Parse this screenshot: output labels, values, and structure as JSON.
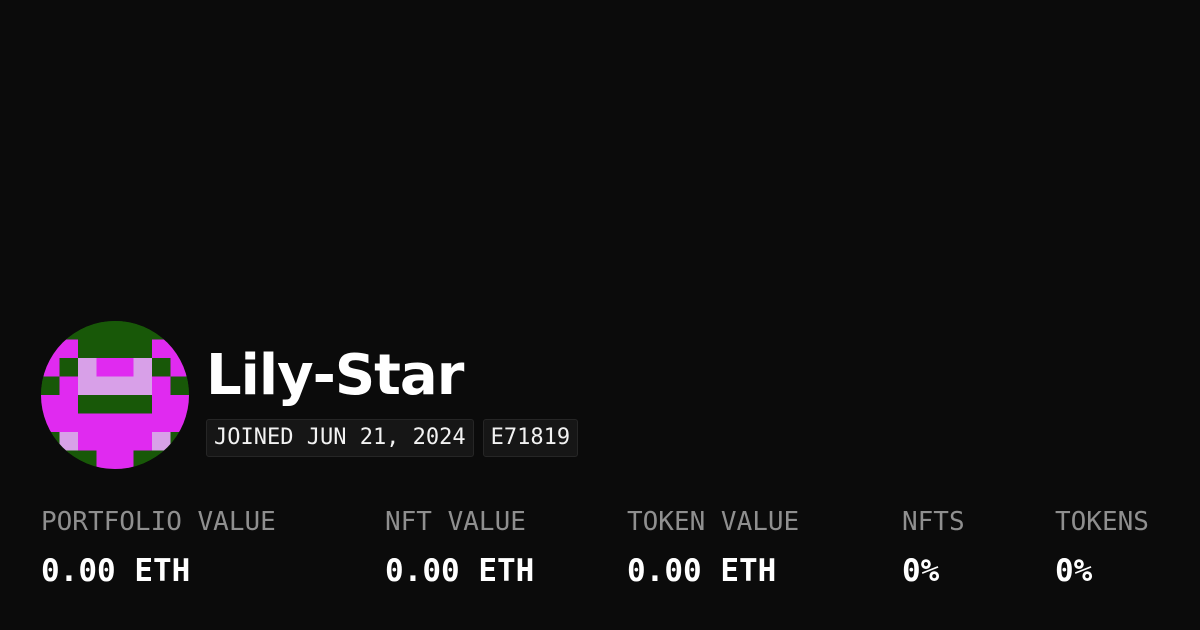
{
  "profile": {
    "username": "Lily-Star",
    "joined": "JOINED JUN 21, 2024",
    "id_badge": "E71819",
    "avatar_colors": {
      "background": "#185808",
      "primary": "#E02AF0",
      "light": "#D8A0E8"
    }
  },
  "stats": [
    {
      "label": "PORTFOLIO VALUE",
      "value": "0.00 ETH"
    },
    {
      "label": "NFT VALUE",
      "value": "0.00 ETH"
    },
    {
      "label": "TOKEN VALUE",
      "value": "0.00 ETH"
    },
    {
      "label": "NFTS",
      "value": "0%"
    },
    {
      "label": "TOKENS",
      "value": "0%"
    }
  ]
}
